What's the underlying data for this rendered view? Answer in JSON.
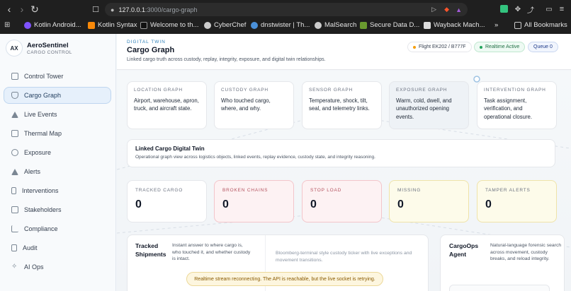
{
  "browser": {
    "url_host": "127.0.0.1",
    "url_path": ":3000/cargo-graph",
    "bookmarks": [
      {
        "label": "Kotlin Android...",
        "color": "#7f52ff"
      },
      {
        "label": "Kotlin Syntax",
        "color": "#f88909"
      },
      {
        "label": "Welcome to th...",
        "color": "#111111"
      },
      {
        "label": "CyberChef",
        "color": "#cccccc"
      },
      {
        "label": "dnstwister | Th...",
        "color": "#4a90d9"
      },
      {
        "label": "MalSearch",
        "color": "#cccccc"
      },
      {
        "label": "Secure Data D...",
        "color": "#6a9a2f"
      },
      {
        "label": "Wayback Mach...",
        "color": "#dddddd"
      }
    ],
    "more_label": "»",
    "all_bookmarks_label": "All Bookmarks"
  },
  "brand": {
    "badge": "AX",
    "name": "AeroSentinel",
    "subtitle": "CARGO CONTROL"
  },
  "nav": [
    {
      "label": "Control Tower"
    },
    {
      "label": "Cargo Graph",
      "active": true
    },
    {
      "label": "Live Events"
    },
    {
      "label": "Thermal Map"
    },
    {
      "label": "Exposure"
    },
    {
      "label": "Alerts"
    },
    {
      "label": "Interventions"
    },
    {
      "label": "Stakeholders"
    },
    {
      "label": "Compliance"
    },
    {
      "label": "Audit"
    },
    {
      "label": "AI Ops"
    }
  ],
  "header": {
    "eyebrow": "DIGITAL TWIN",
    "title": "Cargo Graph",
    "description": "Linked cargo truth across custody, replay, integrity, exposure, and digital twin relationships.",
    "flight_pill": "Flight EK202 / B777F",
    "realtime_pill": "Realtime Active",
    "queue_pill": "Queue 0"
  },
  "graph_cards": [
    {
      "label": "LOCATION GRAPH",
      "text": "Airport, warehouse, apron, truck, and aircraft state."
    },
    {
      "label": "CUSTODY GRAPH",
      "text": "Who touched cargo, where, and why."
    },
    {
      "label": "SENSOR GRAPH",
      "text": "Temperature, shock, tilt, seal, and telemetry links."
    },
    {
      "label": "EXPOSURE GRAPH",
      "text": "Warm, cold, dwell, and unauthorized opening events."
    },
    {
      "label": "INTERVENTION GRAPH",
      "text": "Task assignment, verification, and operational closure."
    }
  ],
  "twin": {
    "title": "Linked Cargo Digital Twin",
    "description": "Operational graph view across logistics objects, linked events, replay evidence, custody state, and integrity reasoning."
  },
  "stats": [
    {
      "label": "TRACKED CARGO",
      "value": "0"
    },
    {
      "label": "BROKEN CHAINS",
      "value": "0"
    },
    {
      "label": "STOP LOAD",
      "value": "0"
    },
    {
      "label": "MISSING",
      "value": "0"
    },
    {
      "label": "TAMPER ALERTS",
      "value": "0"
    }
  ],
  "panels": {
    "tracked": {
      "title": "Tracked Shipments",
      "description": "Instant answer to where cargo is, who touched it, and whether custody is intact."
    },
    "ticker": {
      "description": "Bloomberg-terminal style custody ticker with live exceptions and movement transitions."
    },
    "agent": {
      "title": "CargoOps Agent",
      "description": "Natural-language forensic search across movement, custody breaks, and reload integrity."
    }
  },
  "toast": "Realtime stream reconnecting. The API is reachable, but the live socket is retrying."
}
